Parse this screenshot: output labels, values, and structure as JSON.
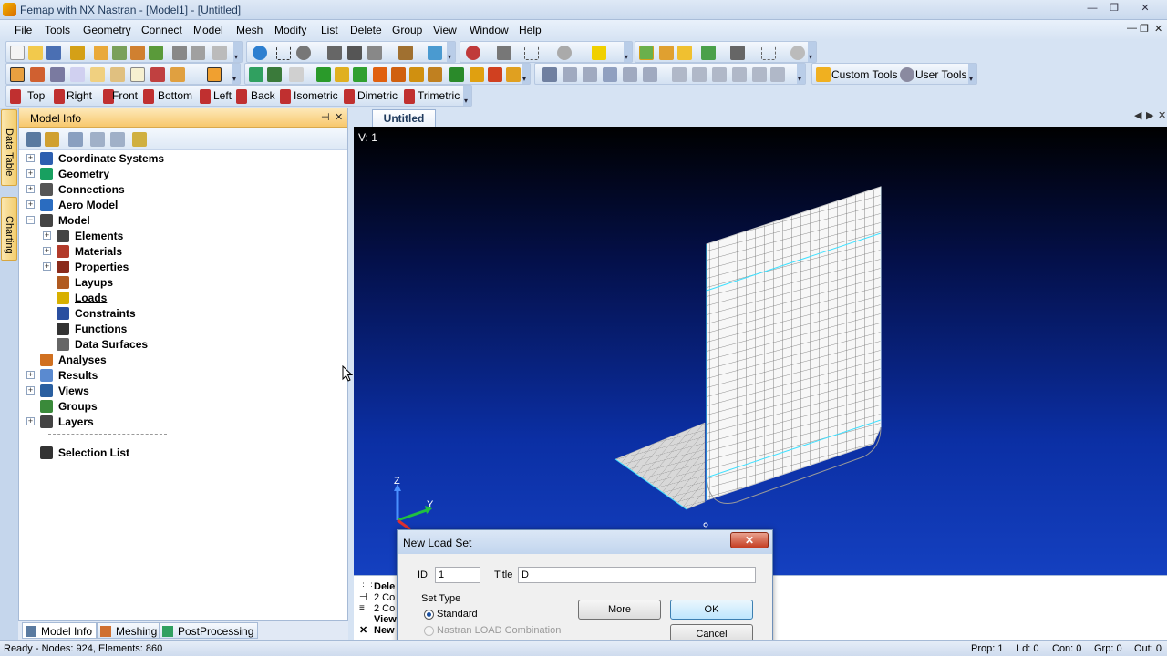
{
  "window": {
    "title": "Femap with NX Nastran - [Model1] - [Untitled]",
    "minimize": "—",
    "restore": "❐",
    "close": "✕"
  },
  "menu": {
    "items": [
      "File",
      "Tools",
      "Geometry",
      "Connect",
      "Model",
      "Mesh",
      "Modify",
      "List",
      "Delete",
      "Group",
      "View",
      "Window",
      "Help"
    ],
    "mdi_buttons": [
      "—",
      "❐",
      "✕"
    ]
  },
  "toolbars": {
    "custom_tools": "Custom Tools",
    "user_tools": "User Tools",
    "views": [
      "Top",
      "Right",
      "Front",
      "Bottom",
      "Left",
      "Back",
      "Isometric",
      "Dimetric",
      "Trimetric"
    ]
  },
  "side_tabs": [
    "Data Table",
    "Charting"
  ],
  "model_info": {
    "title": "Model Info",
    "pin": "⊣",
    "close": "✕",
    "tree": [
      {
        "label": "Coordinate Systems",
        "expander": "+",
        "icon_color": "#2d5fb0"
      },
      {
        "label": "Geometry",
        "expander": "+",
        "icon_color": "#18a060"
      },
      {
        "label": "Connections",
        "expander": "+",
        "icon_color": "#555555"
      },
      {
        "label": "Aero Model",
        "expander": "+",
        "icon_color": "#2a6cc0"
      },
      {
        "label": "Model",
        "expander": "−",
        "icon_color": "#444444"
      },
      {
        "label": "Elements",
        "expander": "+",
        "icon_color": "#444444"
      },
      {
        "label": "Materials",
        "expander": "+",
        "icon_color": "#b23a2a"
      },
      {
        "label": "Properties",
        "expander": "+",
        "icon_color": "#8a2a1a"
      },
      {
        "label": "Layups",
        "expander": "",
        "icon_color": "#b05a20"
      },
      {
        "label": "Loads",
        "expander": "",
        "icon_color": "#d8b000"
      },
      {
        "label": "Constraints",
        "expander": "",
        "icon_color": "#2a4fa0"
      },
      {
        "label": "Functions",
        "expander": "",
        "icon_color": "#333333"
      },
      {
        "label": "Data Surfaces",
        "expander": "",
        "icon_color": "#666666"
      },
      {
        "label": "Analyses",
        "expander": "",
        "icon_color": "#d07020"
      },
      {
        "label": "Results",
        "expander": "+",
        "icon_color": "#5a8ad0"
      },
      {
        "label": "Views",
        "expander": "+",
        "icon_color": "#2a5fa0"
      },
      {
        "label": "Groups",
        "expander": "",
        "icon_color": "#3a8a3a"
      },
      {
        "label": "Layers",
        "expander": "+",
        "icon_color": "#444444"
      },
      {
        "label": "Selection List",
        "expander": "",
        "icon_color": "#333333"
      }
    ],
    "bottom_tabs": [
      "Model Info",
      "Meshing",
      "PostProcessing"
    ]
  },
  "document": {
    "tab": "Untitled",
    "view_label": "V: 1",
    "axis_z": "Z",
    "axis_y": "Y"
  },
  "messages": {
    "lines": [
      "Dele",
      "2 Co",
      "2 Co",
      "View",
      "New"
    ]
  },
  "dialog": {
    "title": "New Load Set",
    "close": "✕",
    "id_label": "ID",
    "id_value": "1",
    "title_label": "Title",
    "title_value": "D",
    "set_type_label": "Set Type",
    "option_standard": "Standard",
    "option_nastran": "Nastran LOAD Combination",
    "more_button": "More",
    "ok_button": "OK",
    "cancel_button": "Cancel"
  },
  "status": {
    "text": "Ready - Nodes: 924,  Elements: 860",
    "prop": "Prop: 1",
    "ld": "Ld: 0",
    "con": "Con: 0",
    "grp": "Grp: 0",
    "out": "Out: 0"
  },
  "colors": {
    "panel_header": "#f8c86d",
    "mesh_highlight": "#3fe0ff",
    "viewport_top": "#000000",
    "viewport_bottom": "#1440c0"
  }
}
